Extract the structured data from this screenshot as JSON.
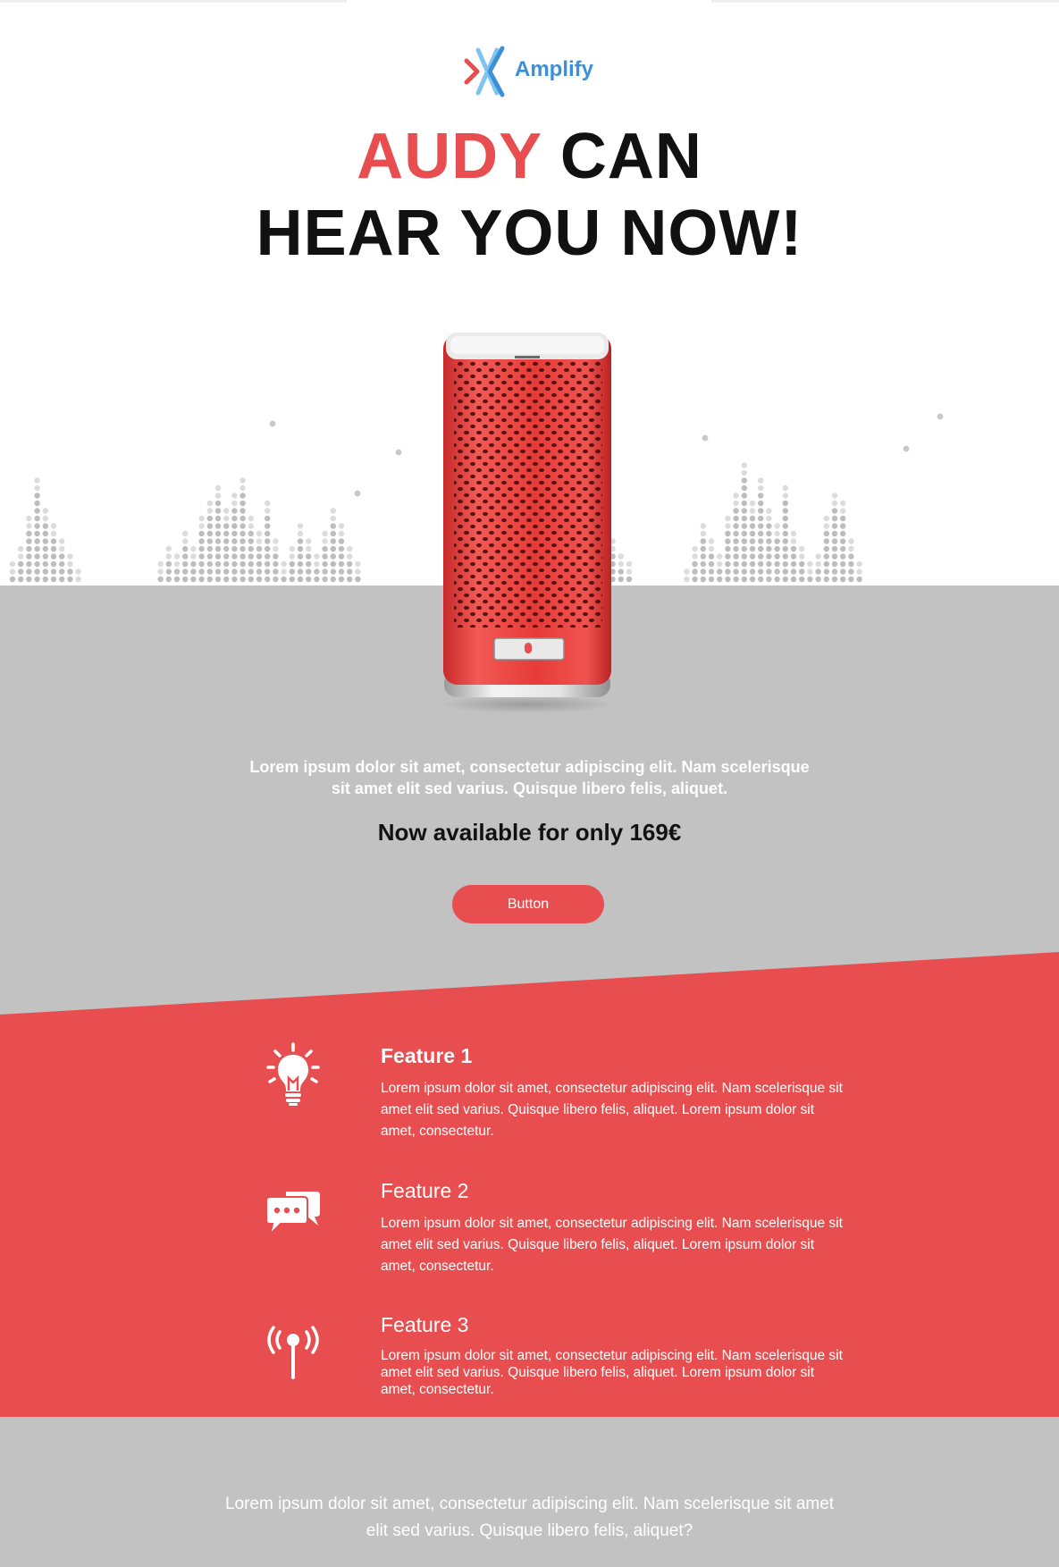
{
  "brand": {
    "name": "Amplify"
  },
  "hero": {
    "headline_accent": "AUDY",
    "headline_rest": " CAN",
    "headline_line2": "HEAR YOU NOW!",
    "intro": "Lorem ipsum dolor sit amet, consectetur adipiscing elit. Nam scelerisque sit amet elit sed varius. Quisque libero felis, aliquet.",
    "price": "Now available for only 169€",
    "button_label": "Button"
  },
  "features": [
    {
      "title": "Feature 1",
      "icon": "lightbulb-icon",
      "body": "Lorem ipsum dolor sit amet, consectetur adipiscing elit. Nam scelerisque sit amet elit sed varius. Quisque libero felis, aliquet. Lorem ipsum dolor sit amet, consectetur."
    },
    {
      "title": "Feature 2",
      "icon": "chat-bubbles-icon",
      "body": "Lorem ipsum dolor sit amet, consectetur adipiscing elit. Nam scelerisque sit amet elit sed varius. Quisque libero felis, aliquet. Lorem ipsum dolor sit amet, consectetur."
    },
    {
      "title": "Feature 3",
      "icon": "antenna-icon",
      "body": "Lorem ipsum dolor sit amet, consectetur adipiscing elit. Nam scelerisque sit amet elit sed varius. Quisque libero felis, aliquet. Lorem ipsum dolor sit amet, consectetur."
    }
  ],
  "outro": "Lorem ipsum dolor sit amet, consectetur adipiscing elit. Nam scelerisque sit amet elit sed varius. Quisque libero felis, aliquet?",
  "colors": {
    "accent": "#e84e4f",
    "gray": "#c2c2c2",
    "logo_blue": "#3d8fd8",
    "text_dark": "#111111"
  }
}
